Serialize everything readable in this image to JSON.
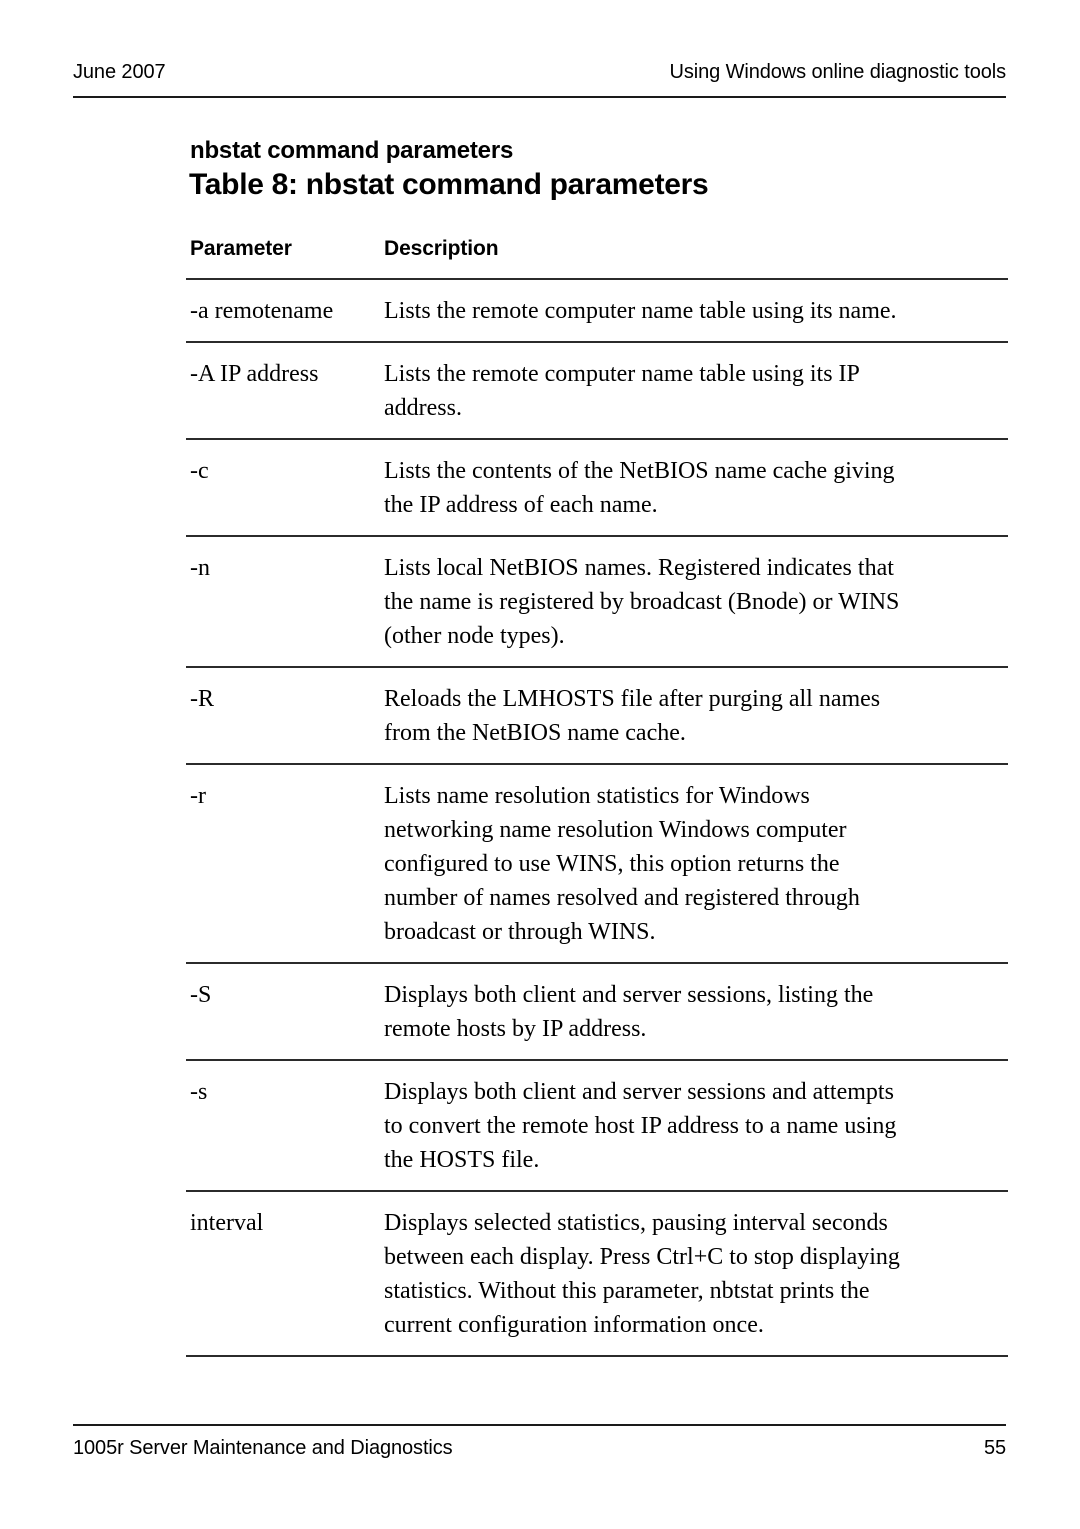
{
  "header": {
    "date": "June 2007",
    "section_title": "Using Windows online diagnostic tools"
  },
  "headings": {
    "subtitle": "nbstat command parameters",
    "table_title": "Table 8: nbstat command parameters"
  },
  "table": {
    "columns": {
      "parameter": "Parameter",
      "description": "Description"
    },
    "rows": [
      {
        "parameter": "-a remotename",
        "description_lines": [
          "Lists the remote computer name table using its name."
        ]
      },
      {
        "parameter": "-A IP address",
        "description_lines": [
          "Lists the remote computer name table using its IP",
          "address."
        ]
      },
      {
        "parameter": "-c",
        "description_lines": [
          "Lists the contents of the NetBIOS name cache giving",
          "the IP address of each name."
        ]
      },
      {
        "parameter": "-n",
        "description_lines": [
          "Lists local NetBIOS names. Registered indicates that",
          "the name is registered by broadcast (Bnode) or WINS",
          "(other node types)."
        ]
      },
      {
        "parameter": "-R",
        "description_lines": [
          "Reloads the LMHOSTS file after purging all names",
          "from the NetBIOS name cache."
        ]
      },
      {
        "parameter": "-r",
        "description_lines": [
          "Lists name resolution statistics for Windows",
          "networking name resolution Windows computer",
          "configured to use WINS, this option returns the",
          "number of names resolved and registered through",
          "broadcast or through WINS."
        ]
      },
      {
        "parameter": "-S",
        "description_lines": [
          "Displays both client and server sessions, listing the",
          "remote hosts by IP address."
        ]
      },
      {
        "parameter": "-s",
        "description_lines": [
          "Displays both client and server sessions and attempts",
          "to convert the remote host IP address to a name using",
          "the HOSTS file."
        ]
      },
      {
        "parameter": "interval",
        "description_lines": [
          "Displays selected statistics, pausing interval seconds",
          "between each display. Press Ctrl+C to stop displaying",
          "statistics. Without this parameter, nbtstat prints the",
          "current configuration information once."
        ]
      }
    ]
  },
  "footer": {
    "document_title": "1005r Server Maintenance and Diagnostics",
    "page_number": "55"
  }
}
